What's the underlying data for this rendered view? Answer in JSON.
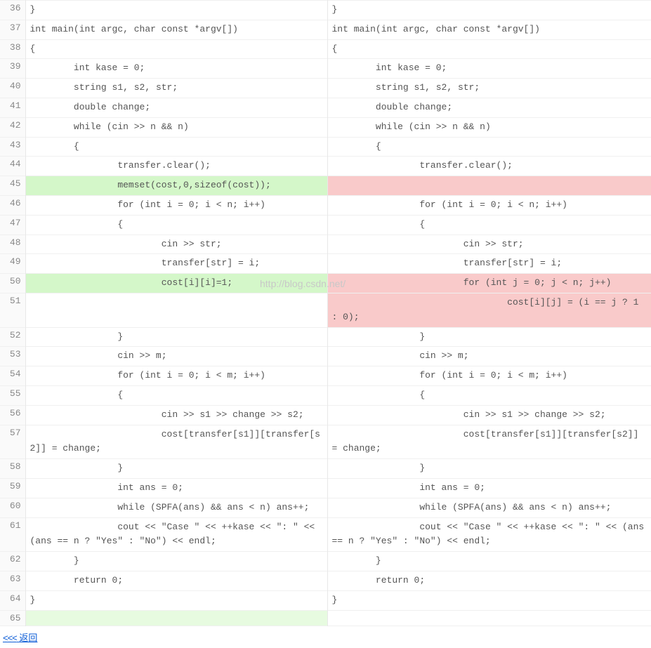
{
  "watermark": "http://blog.csdn.net/",
  "back_link": {
    "arrows": "<<<",
    "label": "返回"
  },
  "rows": [
    {
      "ln": "36",
      "left": {
        "txt": "}"
      },
      "right": {
        "txt": "}"
      }
    },
    {
      "ln": "37",
      "left": {
        "txt": "int main(int argc, char const *argv[])"
      },
      "right": {
        "txt": "int main(int argc, char const *argv[])"
      }
    },
    {
      "ln": "38",
      "left": {
        "txt": "{"
      },
      "right": {
        "txt": "{"
      }
    },
    {
      "ln": "39",
      "left": {
        "txt": "        int kase = 0;"
      },
      "right": {
        "txt": "        int kase = 0;"
      }
    },
    {
      "ln": "40",
      "left": {
        "txt": "        string s1, s2, str;"
      },
      "right": {
        "txt": "        string s1, s2, str;"
      }
    },
    {
      "ln": "41",
      "left": {
        "txt": "        double change;"
      },
      "right": {
        "txt": "        double change;"
      }
    },
    {
      "ln": "42",
      "left": {
        "txt": "        while (cin >> n && n)"
      },
      "right": {
        "txt": "        while (cin >> n && n)"
      }
    },
    {
      "ln": "43",
      "left": {
        "txt": "        {"
      },
      "right": {
        "txt": "        {"
      }
    },
    {
      "ln": "44",
      "left": {
        "txt": "                transfer.clear();"
      },
      "right": {
        "txt": "                transfer.clear();"
      }
    },
    {
      "ln": "45",
      "left": {
        "txt": "                memset(cost,0,sizeof(cost));",
        "cls": "hl-green"
      },
      "right": {
        "txt": "",
        "cls": "hl-red"
      }
    },
    {
      "ln": "46",
      "left": {
        "txt": "                for (int i = 0; i < n; i++)"
      },
      "right": {
        "txt": "                for (int i = 0; i < n; i++)"
      }
    },
    {
      "ln": "47",
      "left": {
        "txt": "                {"
      },
      "right": {
        "txt": "                {"
      }
    },
    {
      "ln": "48",
      "left": {
        "txt": "                        cin >> str;"
      },
      "right": {
        "txt": "                        cin >> str;"
      }
    },
    {
      "ln": "49",
      "left": {
        "txt": "                        transfer[str] = i;"
      },
      "right": {
        "txt": "                        transfer[str] = i;"
      }
    },
    {
      "ln": "50",
      "left": {
        "txt": "                        cost[i][i]=1;",
        "cls": "hl-green"
      },
      "right": {
        "txt": "                        for (int j = 0; j < n; j++)",
        "cls": "hl-red"
      }
    },
    {
      "ln": "51",
      "left": {
        "txt": ""
      },
      "right": {
        "txt": "                                cost[i][j] = (i == j ? 1 : 0);",
        "cls": "hl-red"
      }
    },
    {
      "ln": "52",
      "left": {
        "txt": "                }"
      },
      "right": {
        "txt": "                }"
      }
    },
    {
      "ln": "53",
      "left": {
        "txt": "                cin >> m;"
      },
      "right": {
        "txt": "                cin >> m;"
      }
    },
    {
      "ln": "54",
      "left": {
        "txt": "                for (int i = 0; i < m; i++)"
      },
      "right": {
        "txt": "                for (int i = 0; i < m; i++)"
      }
    },
    {
      "ln": "55",
      "left": {
        "txt": "                {"
      },
      "right": {
        "txt": "                {"
      }
    },
    {
      "ln": "56",
      "left": {
        "txt": "                        cin >> s1 >> change >> s2;"
      },
      "right": {
        "txt": "                        cin >> s1 >> change >> s2;"
      }
    },
    {
      "ln": "57",
      "left": {
        "txt": "                        cost[transfer[s1]][transfer[s2]] = change;"
      },
      "right": {
        "txt": "                        cost[transfer[s1]][transfer[s2]] = change;"
      }
    },
    {
      "ln": "58",
      "left": {
        "txt": "                }"
      },
      "right": {
        "txt": "                }"
      }
    },
    {
      "ln": "59",
      "left": {
        "txt": "                int ans = 0;"
      },
      "right": {
        "txt": "                int ans = 0;"
      }
    },
    {
      "ln": "60",
      "left": {
        "txt": "                while (SPFA(ans) && ans < n) ans++;"
      },
      "right": {
        "txt": "                while (SPFA(ans) && ans < n) ans++;"
      }
    },
    {
      "ln": "61",
      "left": {
        "txt": "                cout << \"Case \" << ++kase << \": \" << (ans == n ? \"Yes\" : \"No\") << endl;"
      },
      "right": {
        "txt": "                cout << \"Case \" << ++kase << \": \" << (ans == n ? \"Yes\" : \"No\") << endl;"
      }
    },
    {
      "ln": "62",
      "left": {
        "txt": "        }"
      },
      "right": {
        "txt": "        }"
      }
    },
    {
      "ln": "63",
      "left": {
        "txt": "        return 0;"
      },
      "right": {
        "txt": "        return 0;"
      }
    },
    {
      "ln": "64",
      "left": {
        "txt": "}"
      },
      "right": {
        "txt": "}"
      }
    },
    {
      "ln": "65",
      "left": {
        "txt": "",
        "cls": "hl-green-light"
      },
      "right": {
        "txt": ""
      }
    }
  ]
}
